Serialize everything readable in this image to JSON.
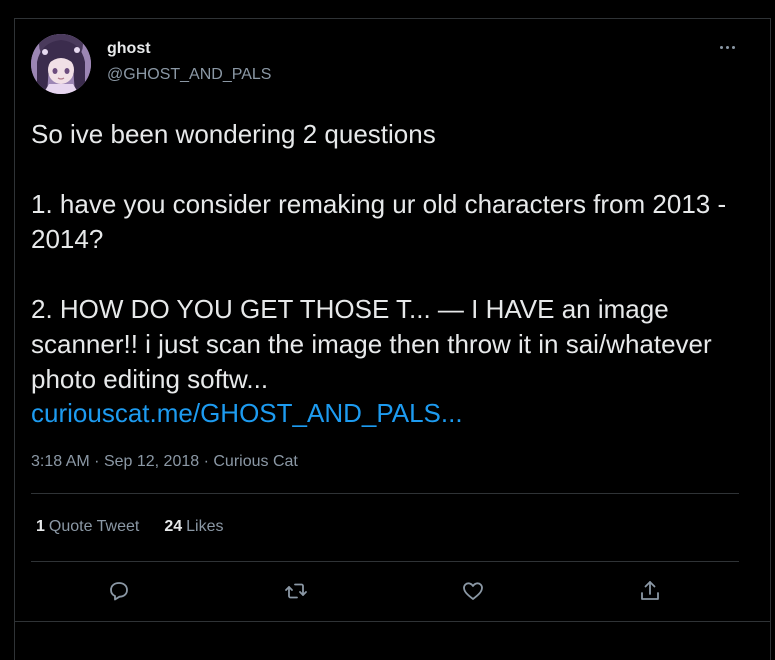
{
  "tweet": {
    "display_name": "ghost",
    "handle": "@GHOST_AND_PALS",
    "text": "So ive been wondering 2 questions\n\n1. have you consider remaking ur old characters from 2013 - 2014?\n\n2. HOW DO YOU GET THOSE T... — I HAVE an image scanner!! i just scan the image then throw it in sai/whatever photo editing softw...",
    "link_text": "curiouscat.me/GHOST_AND_PALS...",
    "time": "3:18 AM",
    "date": "Sep 12, 2018",
    "source": "Curious Cat",
    "separator": "·"
  },
  "stats": {
    "quote_count": "1",
    "quote_label": "Quote Tweet",
    "likes_count": "24",
    "likes_label": "Likes"
  },
  "actions": {
    "reply": "reply-icon",
    "retweet": "retweet-icon",
    "like": "heart-icon",
    "share": "share-icon"
  },
  "colors": {
    "background": "#000000",
    "text": "#e7e9ea",
    "secondary": "#8b98a5",
    "link": "#1d9bf0",
    "border": "#2f3336"
  }
}
